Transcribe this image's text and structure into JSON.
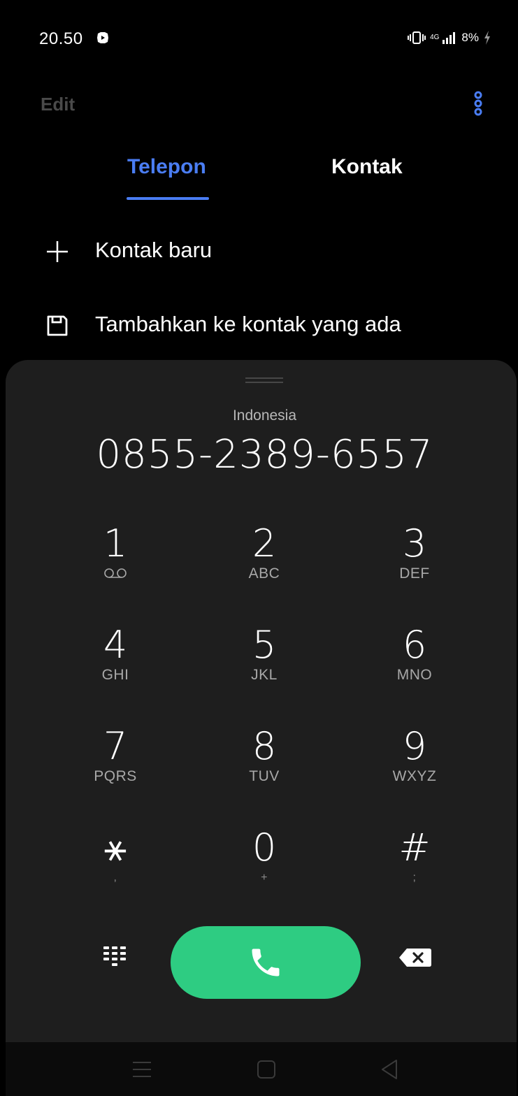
{
  "status_bar": {
    "time": "20.50",
    "network": "4G",
    "battery": "8%"
  },
  "top_bar": {
    "edit_label": "Edit"
  },
  "tabs": [
    {
      "label": "Telepon",
      "active": true
    },
    {
      "label": "Kontak",
      "active": false
    }
  ],
  "actions": {
    "new_contact": "Kontak baru",
    "add_to_existing": "Tambahkan ke kontak yang ada"
  },
  "dialer": {
    "country": "Indonesia",
    "number": "0855-2389-6557",
    "keys": [
      {
        "digit": "1",
        "sub": ""
      },
      {
        "digit": "2",
        "sub": "ABC"
      },
      {
        "digit": "3",
        "sub": "DEF"
      },
      {
        "digit": "4",
        "sub": "GHI"
      },
      {
        "digit": "5",
        "sub": "JKL"
      },
      {
        "digit": "6",
        "sub": "MNO"
      },
      {
        "digit": "7",
        "sub": "PQRS"
      },
      {
        "digit": "8",
        "sub": "TUV"
      },
      {
        "digit": "9",
        "sub": "WXYZ"
      },
      {
        "digit": "⚹",
        "sub": ","
      },
      {
        "digit": "0",
        "sub": "+"
      },
      {
        "digit": "#",
        "sub": ";"
      }
    ]
  },
  "colors": {
    "accent": "#4a7df3",
    "call_green": "#2ecc82",
    "sheet_bg": "#1e1e1e"
  },
  "icons": {
    "status": [
      "app-notification-icon",
      "vibrate-icon",
      "signal-icon",
      "charging-icon"
    ],
    "top": "more-options-icon",
    "actions": [
      "plus-icon",
      "save-icon"
    ],
    "dialer": [
      "voicemail-icon",
      "keypad-icon",
      "phone-icon",
      "backspace-icon"
    ],
    "nav": [
      "menu-icon",
      "home-icon",
      "back-icon"
    ]
  }
}
